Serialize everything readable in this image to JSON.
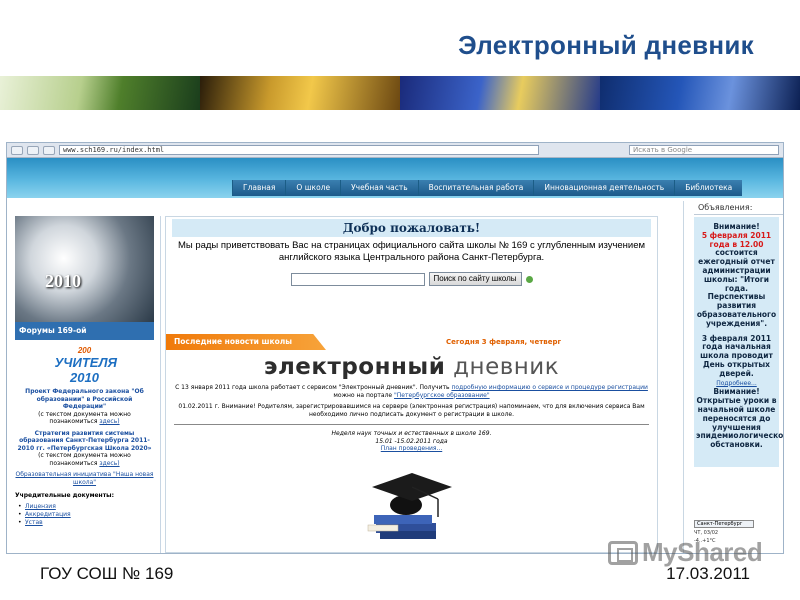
{
  "slide": {
    "title": "Электронный дневник",
    "footer_left": "ГОУ СОШ № 169",
    "footer_right": "17.03.2011",
    "watermark": "MyShared"
  },
  "browser": {
    "address": "www.sch169.ru/index.html",
    "search_placeholder": "Искать в Google"
  },
  "site": {
    "nav": [
      "Главная",
      "О школе",
      "Учебная часть",
      "Воспитательная работа",
      "Инновационная деятельность",
      "Библиотека"
    ],
    "left": {
      "forum": "Форумы 169-ой",
      "clock_year": "2010",
      "logo_line1": "200",
      "logo_line2": "УЧИТЕЛЯ 2010",
      "project_title": "Проект Федерального закона \"Об образовании\" в Российской Федерации\"",
      "project_note": "(с текстом документа можно познакомиться",
      "project_link": "здесь)",
      "strategy_title": "Стратегия развития системы образования Санкт-Петербурга 2011-2010 гг. «Петербургская Школа 2020»",
      "strategy_note": "(с текстом документа можно познакомиться",
      "strategy_link": "здесь)",
      "initiative": "Образовательная инициатива \"Наша новая школа\"",
      "docs_heading": "Учредительные документы:",
      "docs": [
        "Лицензия",
        "Аккредитация",
        "Устав"
      ]
    },
    "center": {
      "welcome": "Добро пожаловать!",
      "intro": "Мы рады приветствовать Вас на страницах официального сайта школы № 169 с углубленным изучением английского языка Центрального района Санкт-Петербурга.",
      "search_button": "Поиск по сайту школы",
      "news_tab": "Последние новости школы",
      "news_date": "Сегодня 3 февраля, четверг",
      "ednv_bold": "электронный",
      "ednv_lite": "дневник",
      "para1": "С 13 января 2011 года школа работает с сервисом \"Электронный дневник\". Получить",
      "para1_link": "подробную информацию о сервисе и процедуре регистрации",
      "para1_mid": "можно на портале",
      "para1_link2": "\"Петербургское образование\"",
      "para2": "01.02.2011 г. Внимание! Родителям, зарегистрировавшимся на сервере (электронная регистрация) напоминаем, что для включения сервиса Вам необходимо лично подписать документ о регистрации в школе.",
      "week_title": "Неделя наук точных и естественных в школе 169.",
      "week_dates": "15.01 -15.02.2011 года",
      "week_link": "План проведения..."
    },
    "right": {
      "heading": "Объявления:",
      "attention": "Внимание!",
      "date1": "5 февраля 2011 года в 12.00",
      "text1": "состоится ежегодный отчет администрации школы: \"Итоги года. Перспективы развития образовательного учреждения\".",
      "date2": "3 февраля 2011 года начальная школа проводит День открытых дверей.",
      "more": "Подробнее...",
      "attention2": "Внимание!",
      "text2": "Открытые уроки в начальной школе переносятся до улучшения эпидемиологической обстановки.",
      "weather_city": "Санкт-Петербург",
      "weather_day": "ЧТ, 03/02",
      "weather_temp": "-4..+1°C"
    }
  }
}
